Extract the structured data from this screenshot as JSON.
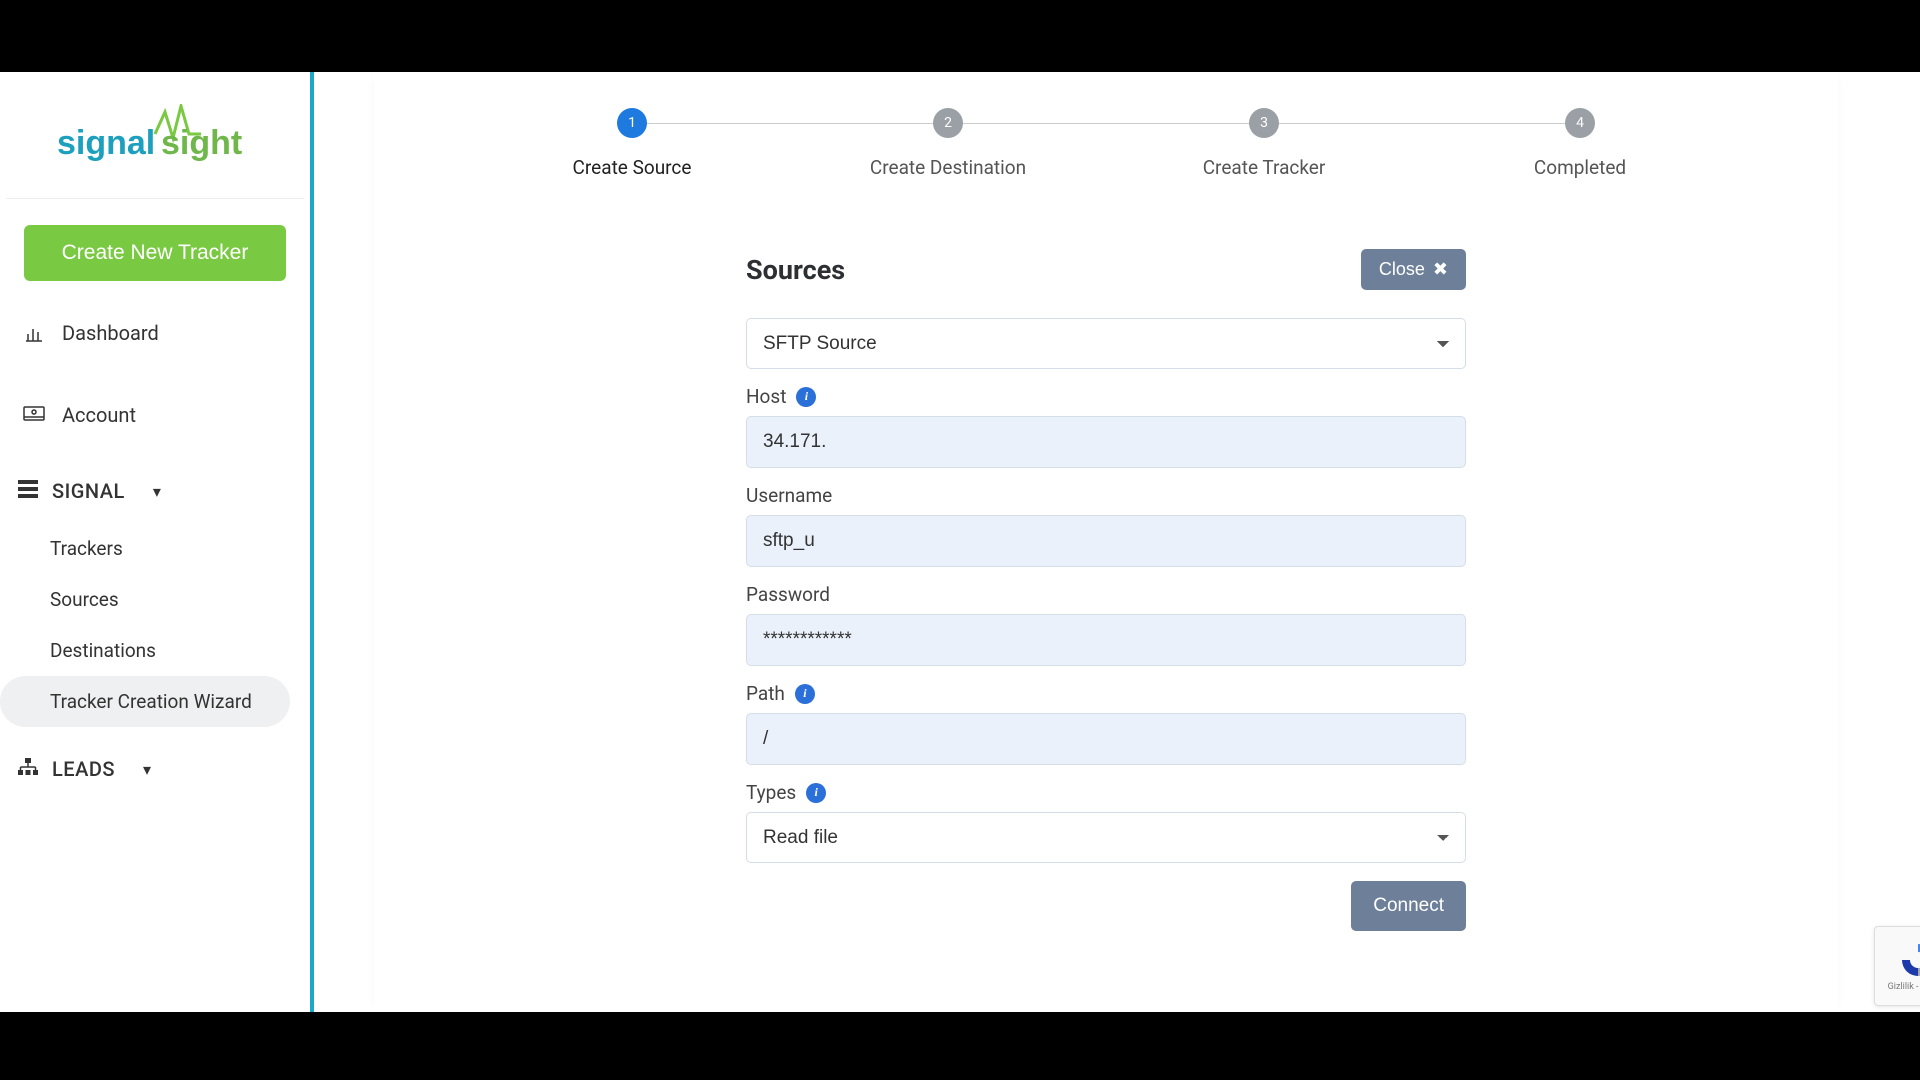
{
  "brand": {
    "name": "signalsight"
  },
  "sidebar": {
    "cta_label": "Create New Tracker",
    "nav": {
      "dashboard": "Dashboard",
      "account": "Account"
    },
    "section_signal": "SIGNAL",
    "signal_items": [
      "Trackers",
      "Sources",
      "Destinations",
      "Tracker Creation Wizard"
    ],
    "section_leads": "LEADS"
  },
  "stepper": {
    "steps": [
      {
        "num": "1",
        "label": "Create Source"
      },
      {
        "num": "2",
        "label": "Create Destination"
      },
      {
        "num": "3",
        "label": "Create Tracker"
      },
      {
        "num": "4",
        "label": "Completed"
      }
    ]
  },
  "form": {
    "title": "Sources",
    "close_label": "Close",
    "source_type": "SFTP Source",
    "host_label": "Host",
    "host_value": "34.171.",
    "username_label": "Username",
    "username_value": "sftp_u",
    "password_label": "Password",
    "password_value": "************",
    "path_label": "Path",
    "path_value": "/",
    "types_label": "Types",
    "types_value": "Read file",
    "connect_label": "Connect"
  },
  "recaptcha": {
    "line": "Gizlilik - Şartlar"
  }
}
